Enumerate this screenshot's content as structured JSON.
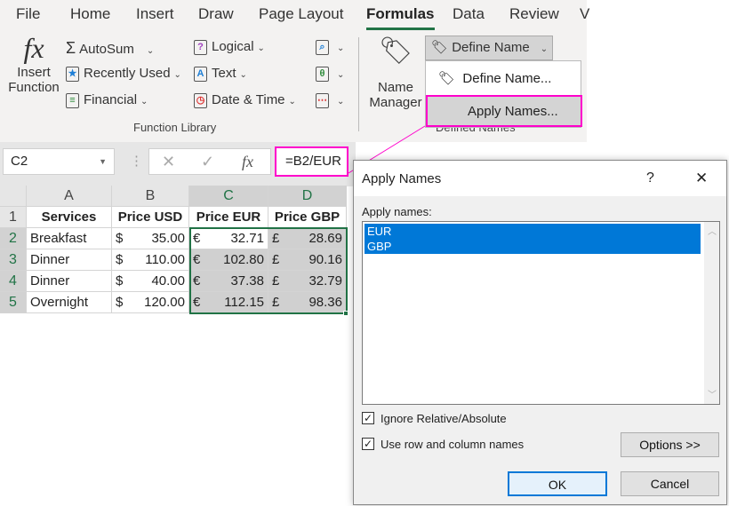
{
  "tabs": [
    "File",
    "Home",
    "Insert",
    "Draw",
    "Page Layout",
    "Formulas",
    "Data",
    "Review",
    "V"
  ],
  "ribbon": {
    "insert_function": [
      "Insert",
      "Function"
    ],
    "autosum": "AutoSum",
    "recently_used": "Recently Used",
    "financial": "Financial",
    "logical": "Logical",
    "text": "Text",
    "date_time": "Date & Time",
    "group_label": "Function Library",
    "name_manager": [
      "Name",
      "Manager"
    ],
    "define_name": "Define Name",
    "defined_names_label": "Defined Names"
  },
  "dropdown": {
    "items": [
      "Define Name...",
      "Apply Names..."
    ]
  },
  "formula_bar": {
    "name_box": "C2",
    "formula": "=B2/EUR"
  },
  "sheet": {
    "columns": [
      "A",
      "B",
      "C",
      "D"
    ],
    "rows": [
      "1",
      "2",
      "3",
      "4",
      "5"
    ],
    "header": [
      "Services",
      "Price USD",
      "Price EUR",
      "Price GBP"
    ],
    "data": [
      [
        "Breakfast",
        "35.00",
        "32.71",
        "28.69"
      ],
      [
        "Dinner",
        "110.00",
        "102.80",
        "90.16"
      ],
      [
        "Dinner",
        "40.00",
        "37.38",
        "32.79"
      ],
      [
        "Overnight",
        "120.00",
        "112.15",
        "98.36"
      ]
    ],
    "symbols": [
      "$",
      "€",
      "£"
    ]
  },
  "dialog": {
    "title": "Apply Names",
    "help": "?",
    "close": "✕",
    "list_label": "Apply names:",
    "names": [
      "EUR",
      "GBP"
    ],
    "ignore_relative": "Ignore Relative/Absolute",
    "use_row_col": "Use row and column names",
    "options": "Options >>",
    "ok": "OK",
    "cancel": "Cancel",
    "ignore_checked": true,
    "use_row_col_checked": true
  },
  "colors": {
    "accent": "#217346",
    "highlight": "#ff00cc",
    "selection": "#0078d7"
  }
}
